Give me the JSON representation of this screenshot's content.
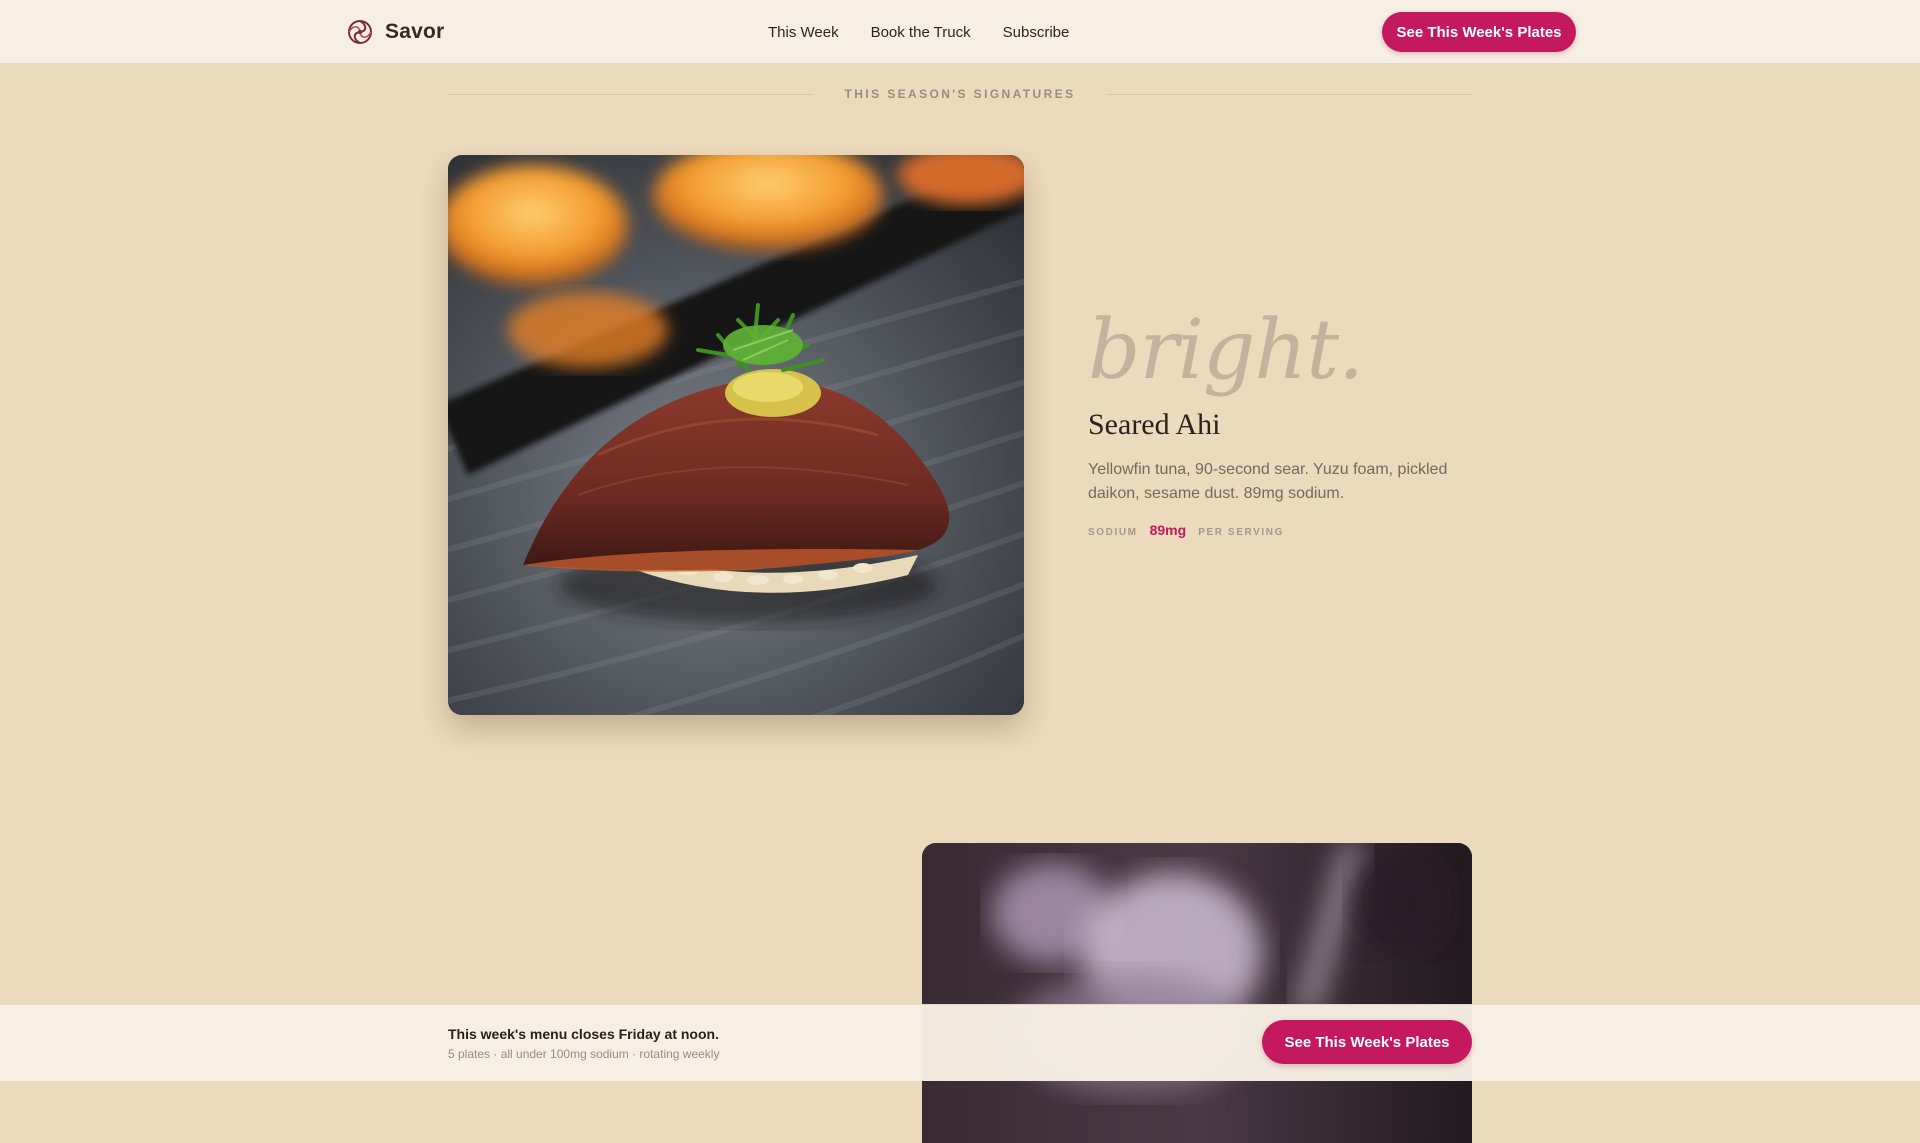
{
  "header": {
    "brand_name": "Savor",
    "nav": [
      "This Week",
      "Book the Truck",
      "Subscribe"
    ],
    "cta_label": "See This Week's Plates"
  },
  "section": {
    "heading": "THIS SEASON'S SIGNATURES"
  },
  "dish": {
    "mood": "bright.",
    "name": "Seared Ahi",
    "description": "Yellowfin tuna, 90-second sear. Yuzu foam, pickled daikon, sesame dust. 89mg sodium.",
    "sodium_label": "SODIUM",
    "sodium_value": "89mg",
    "per_label": "PER SERVING"
  },
  "bottom_bar": {
    "title": "This week's menu closes Friday at noon.",
    "subtitle": "5 plates · all under 100mg sodium · rotating weekly",
    "cta_label": "See This Week's Plates"
  },
  "colors": {
    "accent": "#c4185f",
    "page_bg": "#ecdabd",
    "header_bg": "#f7efe4"
  }
}
